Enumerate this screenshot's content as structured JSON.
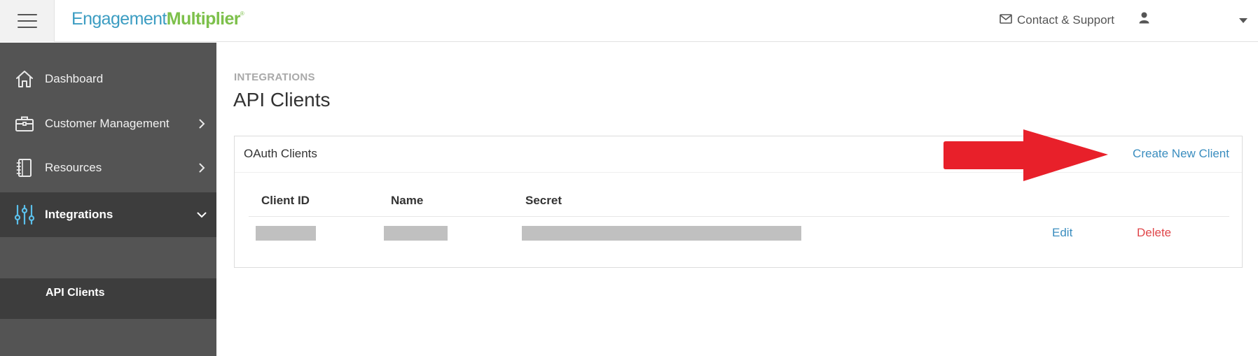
{
  "header": {
    "logo_part1": "Engagement",
    "logo_part2": "Multiplier",
    "logo_mark": "®",
    "contact_label": "Contact & Support"
  },
  "sidebar": {
    "items": [
      {
        "label": "Dashboard",
        "icon": "home-icon"
      },
      {
        "label": "Customer Management",
        "icon": "briefcase-icon"
      },
      {
        "label": "Resources",
        "icon": "notebook-icon"
      },
      {
        "label": "Integrations",
        "icon": "sliders-icon"
      }
    ],
    "subitems": [
      {
        "label": "API Clients"
      }
    ]
  },
  "main": {
    "breadcrumb": "INTEGRATIONS",
    "title": "API Clients",
    "panel": {
      "title": "OAuth Clients",
      "create_label": "Create New Client",
      "columns": [
        "Client ID",
        "Name",
        "Secret"
      ],
      "row": {
        "edit_label": "Edit",
        "delete_label": "Delete"
      }
    }
  },
  "colors": {
    "brand_blue": "#3c9dc2",
    "brand_green": "#7dc04b",
    "sidebar": "#545454",
    "sidebar_active": "#3d3d3d",
    "link": "#3a8dbf",
    "danger": "#e0464a",
    "annotation_arrow": "#e8202a"
  }
}
